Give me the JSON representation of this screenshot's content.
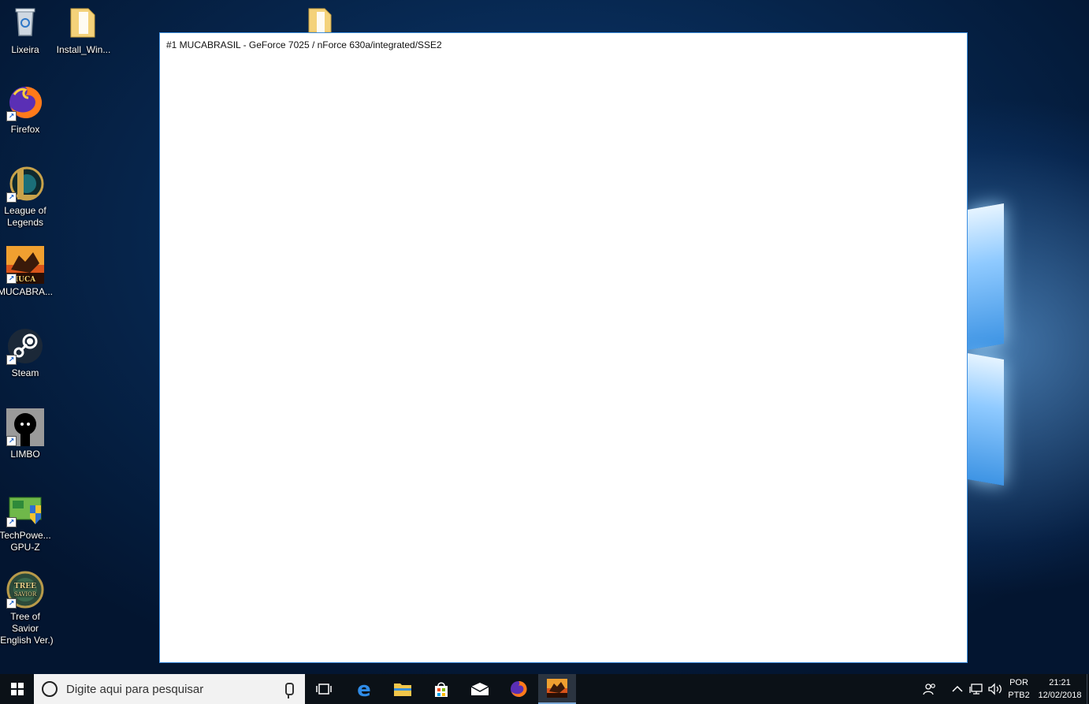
{
  "desktop": {
    "icons": [
      {
        "label": "Lixeira",
        "icon": "recycle-bin-icon"
      },
      {
        "label": "Install_Win...",
        "icon": "folder-icon"
      },
      {
        "label": "Firefox",
        "icon": "firefox-icon"
      },
      {
        "label": "League of Legends",
        "icon": "league-of-legends-icon"
      },
      {
        "label": "MUCABRA...",
        "icon": "mucabrasil-icon"
      },
      {
        "label": "Steam",
        "icon": "steam-icon"
      },
      {
        "label": "LIMBO",
        "icon": "limbo-icon"
      },
      {
        "label": "TechPowe... GPU-Z",
        "icon": "gpu-z-icon"
      },
      {
        "label": "Tree of Savior (English Ver.)",
        "icon": "tree-of-savior-icon"
      }
    ]
  },
  "app_window": {
    "text": "#1 MUCABRASIL - GeForce 7025 / nForce 630a/integrated/SSE2"
  },
  "taskbar": {
    "search_placeholder": "Digite aqui para pesquisar",
    "pinned": [
      "task-view-icon",
      "edge-icon",
      "file-explorer-icon",
      "store-icon",
      "mail-icon",
      "firefox-icon",
      "mucabrasil-icon"
    ],
    "tray": {
      "lang_line1": "POR",
      "lang_line2": "PTB2",
      "time": "21:21",
      "date": "12/02/2018"
    }
  },
  "colors": {
    "desktop_bg": "#06244a",
    "taskbar_bg": "#0b1117",
    "window_border": "#3d8ee0"
  }
}
